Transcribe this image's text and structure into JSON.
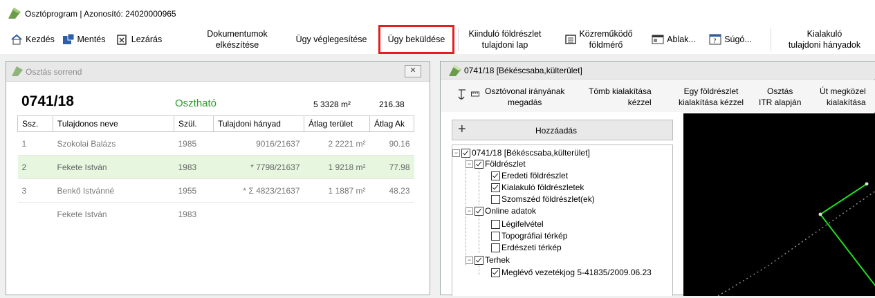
{
  "app": {
    "title": "Osztóprogram | Azonosító: 24020000965"
  },
  "toolbar": {
    "kezdes": "Kezdés",
    "mentes": "Mentés",
    "lezaras": "Lezárás",
    "dok_1": "Dokumentumok",
    "dok_2": "elkészítése",
    "veglegesites": "Ügy véglegesítése",
    "bekuldes": "Ügy beküldése",
    "kiindulo_1": "Kiinduló földrészlet",
    "kiindulo_2": "tulajdoni lap",
    "kozremukodo_1": "Közreműködő",
    "kozremukodo_2": "földmérő",
    "ablak": "Ablak...",
    "sugo": "Súgó...",
    "kialakulo_1": "Kialakuló",
    "kialakulo_2": "tulajdoni hányadok"
  },
  "left": {
    "window_title": "Osztás sorrend",
    "parcel_id": "0741/18",
    "status": "Osztható",
    "status_color": "#2a9a2a",
    "area": "5 3328 m²",
    "ak": "216.38",
    "columns": [
      "Ssz.",
      "Tulajdonos neve",
      "Szül.",
      "Tulajdoni hányad",
      "Átlag terület",
      "Átlag Ak"
    ],
    "rows": [
      {
        "ssz": "1",
        "nev": "Szokolai Balázs",
        "szul": "1985",
        "hanyad": "9016/21637",
        "terulet": "2 2221 m²",
        "ak": "90.16"
      },
      {
        "ssz": "2",
        "nev": "Fekete István",
        "szul": "1983",
        "hanyad": "* 7798/21637",
        "terulet": "1 9218 m²",
        "ak": "77.98"
      },
      {
        "ssz": "3",
        "nev": "Benkő Istvánné",
        "szul": "1955",
        "hanyad": "* Σ 4823/21637",
        "terulet": "1 1887 m²",
        "ak": "48.23"
      },
      {
        "ssz": "",
        "nev": "Fekete István",
        "szul": "1983",
        "hanyad": "",
        "terulet": "",
        "ak": ""
      }
    ]
  },
  "right": {
    "window_title": "0741/18 [Békéscsaba,külterület]",
    "tools": {
      "osztovonal_1": "Osztóvonal irányának",
      "osztovonal_2": "megadás",
      "tomb_1": "Tömb kialakítása",
      "tomb_2": "kézzel",
      "egy_1": "Egy földrészlet",
      "egy_2": "kialakítása kézzel",
      "osztas_1": "Osztás",
      "osztas_2": "ITR alapján",
      "ut_1": "Út megközel",
      "ut_2": "kialakítása"
    },
    "add_label": "Hozzáadás",
    "tree": {
      "root": "0741/18 [Békéscsaba,külterület]",
      "foldreszlet": "Földrészlet",
      "eredeti": "Eredeti földrészlet",
      "kialakulo": "Kialakuló földrészletek",
      "szomszed": "Szomszéd földrészlet(ek)",
      "online": "Online adatok",
      "legi": "Légifelvétel",
      "topo": "Topográfiai térkép",
      "erdo": "Erdészeti térkép",
      "terhek": "Terhek",
      "vezetek": "Meglévő vezetékjog 5-41835/2009.06.23"
    }
  }
}
